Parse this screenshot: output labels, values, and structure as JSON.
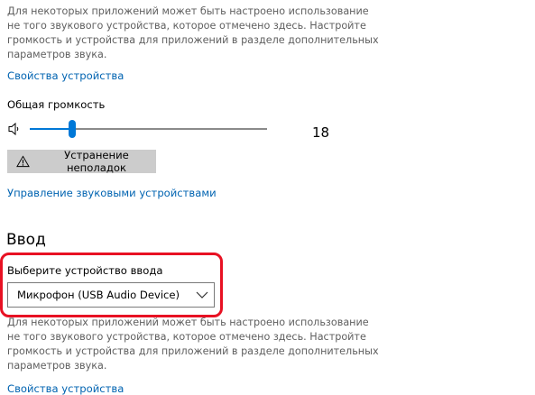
{
  "output": {
    "info_lines": [
      "Для некоторых приложений может быть настроено использование",
      "не того звукового устройства, которое отмечено здесь. Настройте",
      "громкость и устройства для приложений в разделе дополнительных",
      "параметров звука."
    ],
    "device_properties_link": "Свойства устройства",
    "volume_label": "Общая громкость",
    "volume_value": "18",
    "volume_level": 0.18,
    "troubleshoot_label": "Устранение неполадок",
    "manage_devices_link": "Управление звуковыми устройствами"
  },
  "input": {
    "heading": "Ввод",
    "select_label": "Выберите устройство ввода",
    "selected_device": "Микрофон (USB Audio Device)",
    "info_lines": [
      "Для некоторых приложений может быть настроено использование",
      "не того звукового устройства, которое отмечено здесь. Настройте",
      "громкость и устройства для приложений в разделе дополнительных",
      "параметров звука."
    ],
    "device_properties_link": "Свойства устройства"
  },
  "colors": {
    "accent": "#0078d7",
    "link": "#0063b1",
    "annotation": "#e81123",
    "button_bg": "#cccccc"
  },
  "icons": {
    "volume": "speaker-icon",
    "troubleshoot": "warning-icon",
    "dropdown": "chevron-down-icon"
  }
}
